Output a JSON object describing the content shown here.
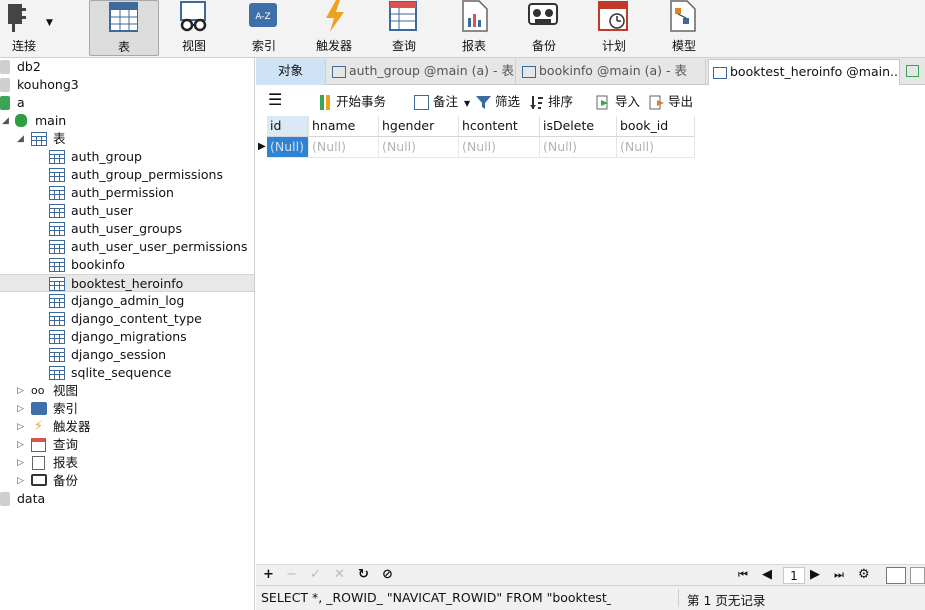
{
  "toolbar": {
    "buttons": [
      {
        "label": "连接",
        "icon": "plug-icon"
      },
      {
        "label": "表",
        "icon": "table-icon"
      },
      {
        "label": "视图",
        "icon": "glasses-icon"
      },
      {
        "label": "索引",
        "icon": "index-icon"
      },
      {
        "label": "触发器",
        "icon": "lightning-icon"
      },
      {
        "label": "查询",
        "icon": "query-icon"
      },
      {
        "label": "报表",
        "icon": "report-icon"
      },
      {
        "label": "备份",
        "icon": "tape-icon"
      },
      {
        "label": "计划",
        "icon": "calendar-clock-icon"
      },
      {
        "label": "模型",
        "icon": "model-icon"
      }
    ]
  },
  "tree": {
    "connections": [
      "db2",
      "kouhong3",
      "a"
    ],
    "database": "main",
    "tables_folder": "表",
    "tables": [
      "auth_group",
      "auth_group_permissions",
      "auth_permission",
      "auth_user",
      "auth_user_groups",
      "auth_user_user_permissions",
      "bookinfo",
      "booktest_heroinfo",
      "django_admin_log",
      "django_content_type",
      "django_migrations",
      "django_session",
      "sqlite_sequence"
    ],
    "selected_table": "booktest_heroinfo",
    "folders": [
      "视图",
      "索引",
      "触发器",
      "查询",
      "报表",
      "备份"
    ],
    "other_db": "data"
  },
  "tabs": {
    "objects": "对象",
    "items": [
      "auth_group @main (a) - 表",
      "bookinfo @main (a) - 表",
      "booktest_heroinfo @main..."
    ]
  },
  "grid_toolbar": {
    "begin_transaction": "开始事务",
    "memo": "备注",
    "filter": "筛选",
    "sort": "排序",
    "import": "导入",
    "export": "导出"
  },
  "grid": {
    "columns": [
      "id",
      "hname",
      "hgender",
      "hcontent",
      "isDelete",
      "book_id"
    ],
    "rows": [
      [
        "(Null)",
        "(Null)",
        "(Null)",
        "(Null)",
        "(Null)",
        "(Null)"
      ]
    ]
  },
  "bottom_nav": {
    "page": "1"
  },
  "status": {
    "sql": "SELECT *, _ROWID_ \"NAVICAT_ROWID\" FROM \"booktest_heroinfo\"",
    "records": "第 1 页无记录"
  },
  "colors": {
    "accent": "#2f82d4",
    "tab_objects": "#cfe3f7",
    "db_icon": "#2e9e3e"
  }
}
